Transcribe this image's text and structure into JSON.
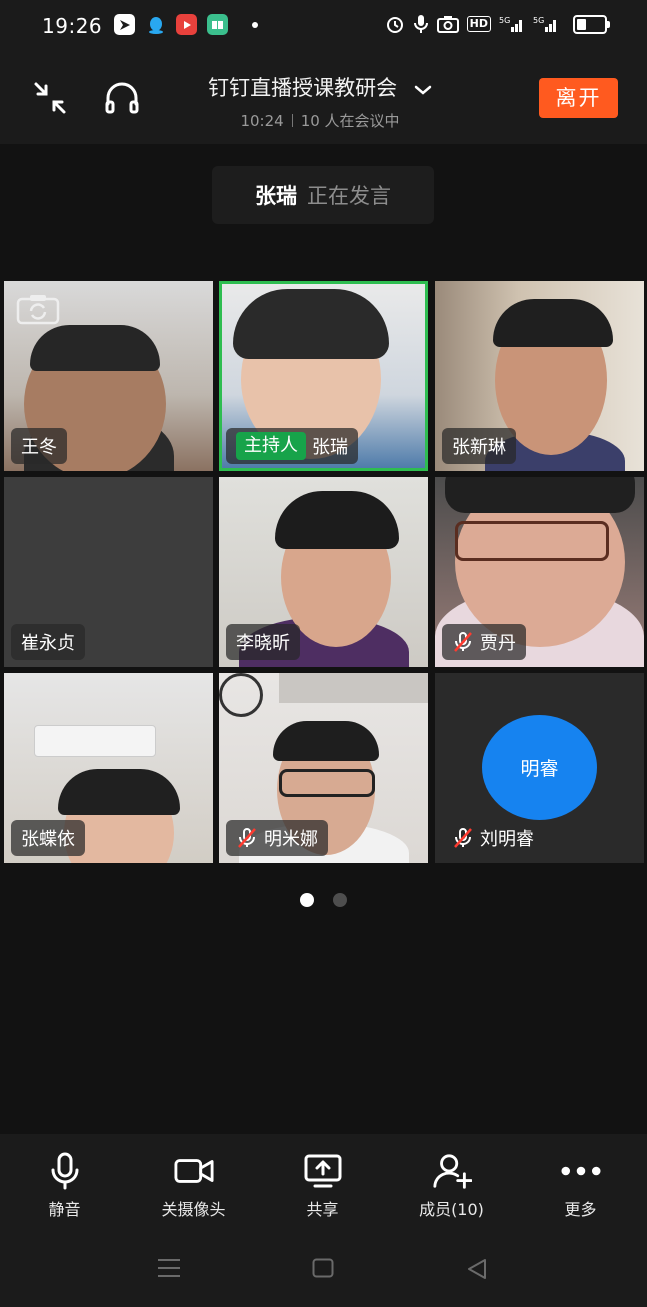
{
  "status_bar": {
    "time": "19:26"
  },
  "header": {
    "title": "钉钉直播授课教研会",
    "duration": "10:24",
    "participants_text": "10 人在会议中",
    "leave_label": "离开"
  },
  "speaking": {
    "name": "张瑞",
    "status": "正在发言"
  },
  "tiles": [
    {
      "name": "王冬",
      "muted": false
    },
    {
      "name": "张瑞",
      "host_label": "主持人",
      "muted": false,
      "active": true
    },
    {
      "name": "张新琳",
      "muted": false
    },
    {
      "name": "崔永贞",
      "muted": false,
      "camera_off": true
    },
    {
      "name": "李晓昕",
      "muted": false
    },
    {
      "name": "贾丹",
      "muted": true
    },
    {
      "name": "张蝶依",
      "muted": false
    },
    {
      "name": "明米娜",
      "muted": true
    },
    {
      "name": "刘明睿",
      "muted": true,
      "avatar_text": "明睿",
      "avatar_color": "#1683f0"
    }
  ],
  "pager": {
    "page_count": 2,
    "current": 1
  },
  "toolbar": {
    "mute_label": "静音",
    "camera_label": "关摄像头",
    "share_label": "共享",
    "members_label": "成员(10)",
    "more_label": "更多"
  },
  "colors": {
    "accent_leave": "#ff5a1f",
    "host_green": "#17a34a",
    "avatar_blue": "#1683f0"
  }
}
